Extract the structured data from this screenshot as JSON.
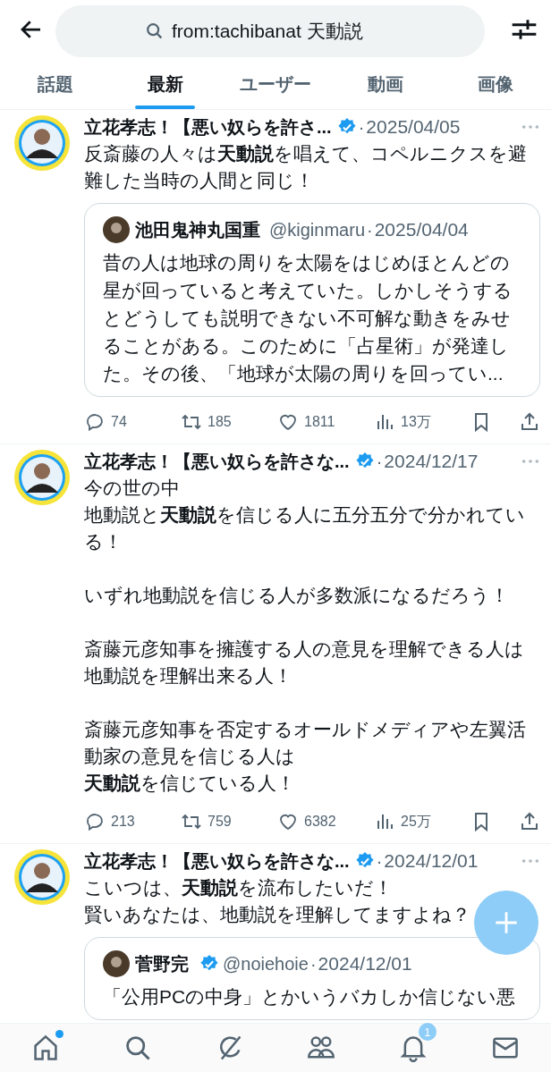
{
  "header": {
    "search": {
      "value": "from:tachibanat 天動説"
    }
  },
  "tabs": [
    {
      "label": "話題",
      "selected": false
    },
    {
      "label": "最新",
      "selected": true
    },
    {
      "label": "ユーザー",
      "selected": false
    },
    {
      "label": "動画",
      "selected": false
    },
    {
      "label": "画像",
      "selected": false
    }
  ],
  "tweets": [
    {
      "name": "立花孝志！【悪い奴らを許さ...",
      "verified": true,
      "separator": "·",
      "date": "2025/04/05",
      "paragraphs": [
        [
          "反斎藤の人々は**天動説**を唱えて、コペルニクスを避難した当時の人間と同じ！"
        ]
      ],
      "quote": {
        "name": "池田鬼神丸国重",
        "verified": false,
        "handle": "@kiginmaru",
        "separator": "·",
        "date": "2025/04/04",
        "text": "昔の人は地球の周りを太陽をはじめほとんどの星が回っていると考えていた。しかしそうするとどうしても説明できない不可解な動きをみせることがある。このために「占星術」が発達した。その後、「地球が太陽の周りを回ってい..."
      },
      "metrics": {
        "replies": "74",
        "reposts": "185",
        "likes": "1811",
        "views": "13万"
      }
    },
    {
      "name": "立花孝志！【悪い奴らを許さな...",
      "verified": true,
      "separator": "·",
      "date": "2024/12/17",
      "paragraphs": [
        [
          "今の世の中",
          "地動説と**天動説**を信じる人に五分五分で分かれている！"
        ],
        [
          "いずれ地動説を信じる人が多数派になるだろう！"
        ],
        [
          "斎藤元彦知事を擁護する人の意見を理解できる人は地動説を理解出来る人！"
        ],
        [
          "斎藤元彦知事を否定するオールドメディアや左翼活動家の意見を信じる人は",
          "**天動説**を信じている人！"
        ]
      ],
      "metrics": {
        "replies": "213",
        "reposts": "759",
        "likes": "6382",
        "views": "25万"
      }
    },
    {
      "name": "立花孝志！【悪い奴らを許さな...",
      "verified": true,
      "separator": "·",
      "date": "2024/12/01",
      "paragraphs": [
        [
          "こいつは、**天動説**を流布したいだ！",
          "賢いあなたは、地動説を理解してますよね？"
        ]
      ],
      "quote": {
        "name": "菅野完",
        "verified": true,
        "handle": "@noiehoie",
        "separator": "·",
        "date": "2024/12/01",
        "text": "「公用PCの中身」とかいうバカしか信じない悪"
      }
    }
  ],
  "bottom_nav": [
    {
      "kind": "home",
      "dot": true
    },
    {
      "kind": "search",
      "dot": false
    },
    {
      "kind": "slash",
      "dot": false
    },
    {
      "kind": "people",
      "dot": false
    },
    {
      "kind": "bell",
      "dot": false,
      "badge": "1"
    },
    {
      "kind": "mail",
      "dot": false
    }
  ]
}
